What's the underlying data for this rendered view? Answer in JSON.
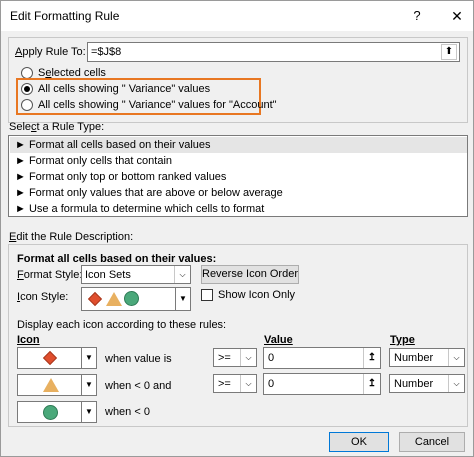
{
  "window": {
    "title": "Edit Formatting Rule",
    "help_glyph": "?",
    "close_glyph": "✕"
  },
  "apply_rule": {
    "label_underlined": "A",
    "label_rest": "pply Rule To:",
    "value": "=$J$8",
    "collapse_glyph": "⬆"
  },
  "scope_options": [
    {
      "label_pre": "S",
      "label_u": "e",
      "label_post": "lected cells",
      "checked": false
    },
    {
      "label": "All cells showing \" Variance\" values",
      "checked": true
    },
    {
      "label": "All cells showing \" Variance\" values for \"Account\"",
      "checked": false
    }
  ],
  "rule_type": {
    "label_pre": "Sele",
    "label_u": "c",
    "label_post": "t a Rule Type:",
    "items": [
      "► Format all cells based on their values",
      "► Format only cells that contain",
      "► Format only top or bottom ranked values",
      "► Format only values that are above or below average",
      "► Use a formula to determine which cells to format"
    ],
    "selected_index": 0
  },
  "description": {
    "label_pre": "",
    "label_u": "E",
    "label_post": "dit the Rule Description:",
    "heading": "Format all cells based on their values:",
    "format_style_label_u": "O",
    "format_style_label_rest": "Format Style:",
    "format_style_value": "Icon Sets",
    "reverse_button": "Reverse Icon Order",
    "icon_style_label_pre": "",
    "icon_style_label_u": "I",
    "icon_style_label_rest": "con Style:",
    "show_icon_only_label": "Show Icon Only",
    "display_rules_label": "Display each icon according to these rules:",
    "col_icon": "Icon",
    "col_value": "Value",
    "col_type": "Type",
    "rows": [
      {
        "icon": "red-diamond-icon",
        "condition": "when value is",
        "operator": ">=",
        "value": "0",
        "type": "Number"
      },
      {
        "icon": "yellow-triangle-icon",
        "condition": "when < 0 and",
        "operator": ">=",
        "value": "0",
        "type": "Number"
      },
      {
        "icon": "green-circle-icon",
        "condition": "when < 0"
      }
    ]
  },
  "footer": {
    "ok_label": "OK",
    "cancel_label": "Cancel"
  },
  "colors": {
    "highlight": "#e87722",
    "icon_red": "#e04e2d",
    "icon_yellow": "#e8b060",
    "icon_green": "#4aa87a",
    "ok_border": "#0078d7"
  }
}
